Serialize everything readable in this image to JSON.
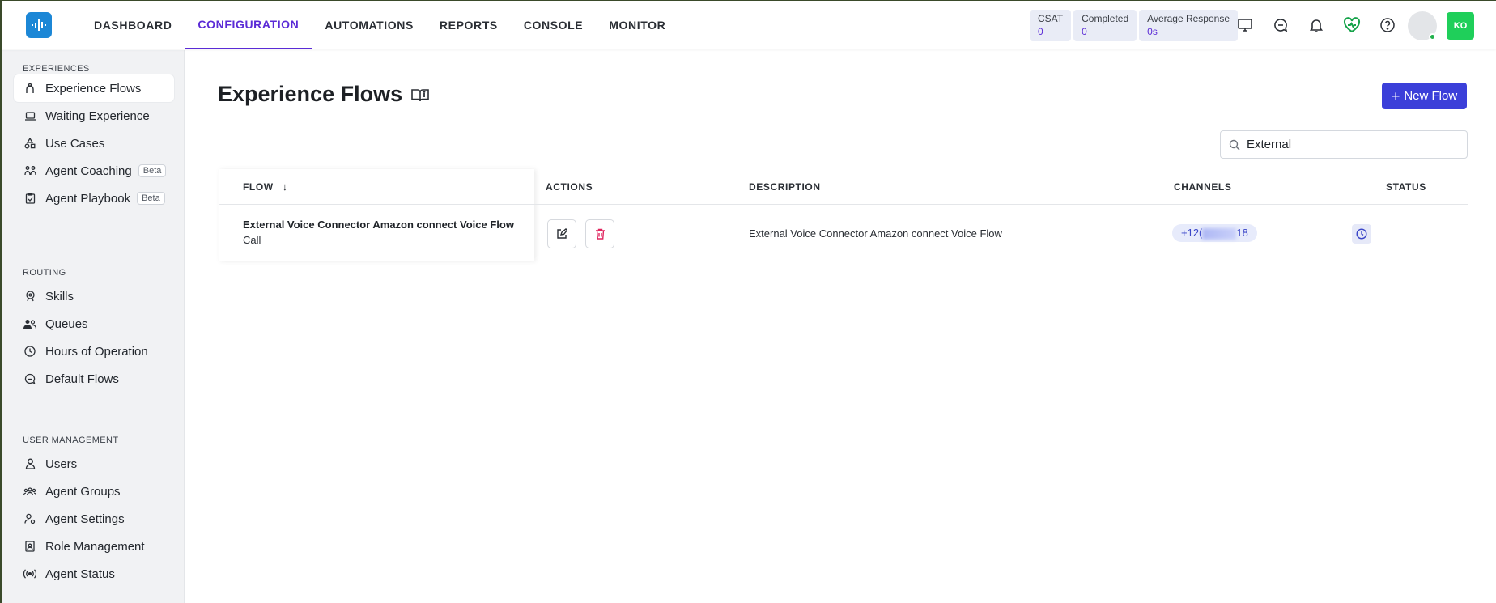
{
  "nav": {
    "items": [
      "DASHBOARD",
      "CONFIGURATION",
      "AUTOMATIONS",
      "REPORTS",
      "CONSOLE",
      "MONITOR"
    ],
    "active": "CONFIGURATION"
  },
  "metrics": [
    {
      "label": "CSAT",
      "value": "0"
    },
    {
      "label": "Completed",
      "value": "0"
    },
    {
      "label": "Average Response",
      "value": "0s"
    }
  ],
  "user": {
    "initials": "KO"
  },
  "sidebar": {
    "sections": [
      {
        "title": "EXPERIENCES",
        "items": [
          {
            "label": "Experience Flows",
            "icon": "flow-icon",
            "active": true
          },
          {
            "label": "Waiting Experience",
            "icon": "laptop-icon"
          },
          {
            "label": "Use Cases",
            "icon": "shapes-icon"
          },
          {
            "label": "Agent Coaching",
            "icon": "coaching-icon",
            "badge": "Beta"
          },
          {
            "label": "Agent Playbook",
            "icon": "clipboard-icon",
            "badge": "Beta"
          }
        ]
      },
      {
        "title": "ROUTING",
        "items": [
          {
            "label": "Skills",
            "icon": "skills-icon"
          },
          {
            "label": "Queues",
            "icon": "users-icon"
          },
          {
            "label": "Hours of Operation",
            "icon": "clock-icon"
          },
          {
            "label": "Default Flows",
            "icon": "chat-icon"
          }
        ]
      },
      {
        "title": "USER MANAGEMENT",
        "items": [
          {
            "label": "Users",
            "icon": "user-icon"
          },
          {
            "label": "Agent Groups",
            "icon": "group-icon"
          },
          {
            "label": "Agent Settings",
            "icon": "user-settings-icon"
          },
          {
            "label": "Role Management",
            "icon": "badge-icon"
          },
          {
            "label": "Agent Status",
            "icon": "broadcast-icon"
          }
        ]
      }
    ]
  },
  "page": {
    "title": "Experience Flows",
    "new_button": "New Flow",
    "search_value": "External"
  },
  "table": {
    "columns": [
      "FLOW",
      "ACTIONS",
      "DESCRIPTION",
      "CHANNELS",
      "STATUS"
    ],
    "sort_indicator": "↓",
    "rows": [
      {
        "flow": "External Voice Connector Amazon connect Voice Flow",
        "type": "Call",
        "description": "External Voice Connector Amazon connect Voice Flow",
        "channel_prefix": "+12(",
        "channel_suffix": "18"
      }
    ]
  },
  "colors": {
    "accent": "#5b2bd6",
    "primary_button": "#3b3fd9",
    "logo": "#1c87d6",
    "user_badge": "#1fcf5a"
  }
}
